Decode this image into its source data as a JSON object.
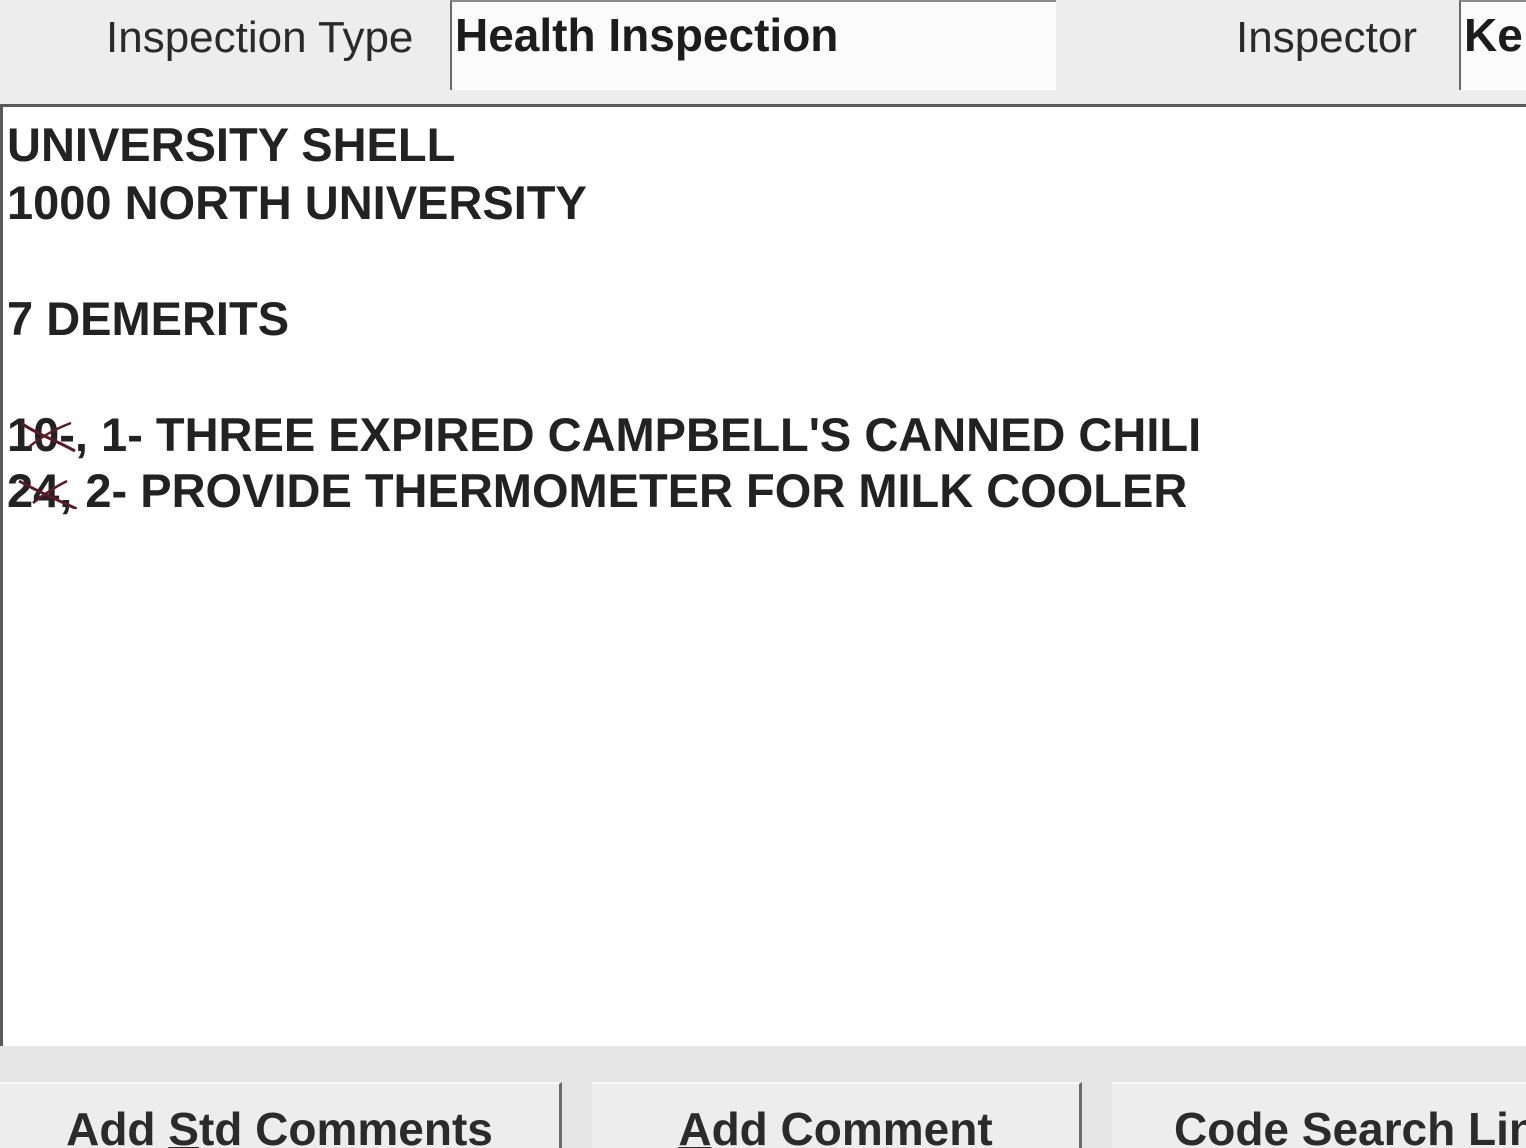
{
  "header": {
    "inspection_type_label": "Inspection Type",
    "inspection_type_value": "Health Inspection",
    "inspector_label": "Inspector",
    "inspector_value": "Ke"
  },
  "comments": {
    "establishment": "UNIVERSITY SHELL",
    "address": "1000 NORTH UNIVERSITY",
    "demerits": "7 DEMERITS",
    "violations": [
      {
        "code": "10",
        "suffix": "-, 1- THREE EXPIRED CAMPBELL'S CANNED CHILI"
      },
      {
        "code": "24",
        "suffix": ", 2- PROVIDE THERMOMETER FOR MILK COOLER"
      }
    ]
  },
  "buttons": {
    "add_std_comments": {
      "pre": "Add ",
      "key": "S",
      "post": "td Comments"
    },
    "add_comment": {
      "pre": "",
      "key": "A",
      "post": "dd Comment"
    },
    "code_search": {
      "label": "Code Search Lin"
    }
  },
  "colors": {
    "strike_mark": "#5a1a2a"
  }
}
